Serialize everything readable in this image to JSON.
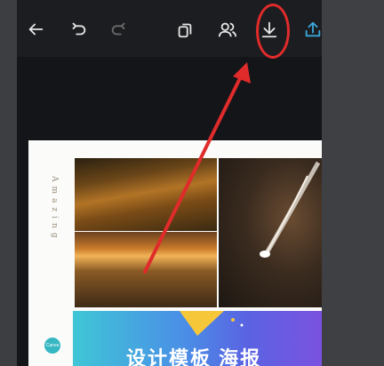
{
  "toolbar": {
    "items": [
      {
        "name": "back-button",
        "icon": "arrow-left-icon"
      },
      {
        "name": "undo-button",
        "icon": "undo-icon"
      },
      {
        "name": "redo-button",
        "icon": "redo-icon"
      },
      {
        "name": "layers-button",
        "icon": "layers-icon"
      },
      {
        "name": "collaborate-button",
        "icon": "users-icon"
      },
      {
        "name": "download-button",
        "icon": "download-icon"
      },
      {
        "name": "share-button",
        "icon": "share-upload-icon"
      }
    ],
    "icon_color": "#e6e6e6",
    "disabled_icon_color": "#6b6b6b",
    "share_icon_color": "#3aa6d8"
  },
  "poster": {
    "vertical_text": "Amazing",
    "badge_text": "Canva",
    "banner_text": "设计模板 海报"
  },
  "annotation": {
    "color": "#e02b2b"
  }
}
